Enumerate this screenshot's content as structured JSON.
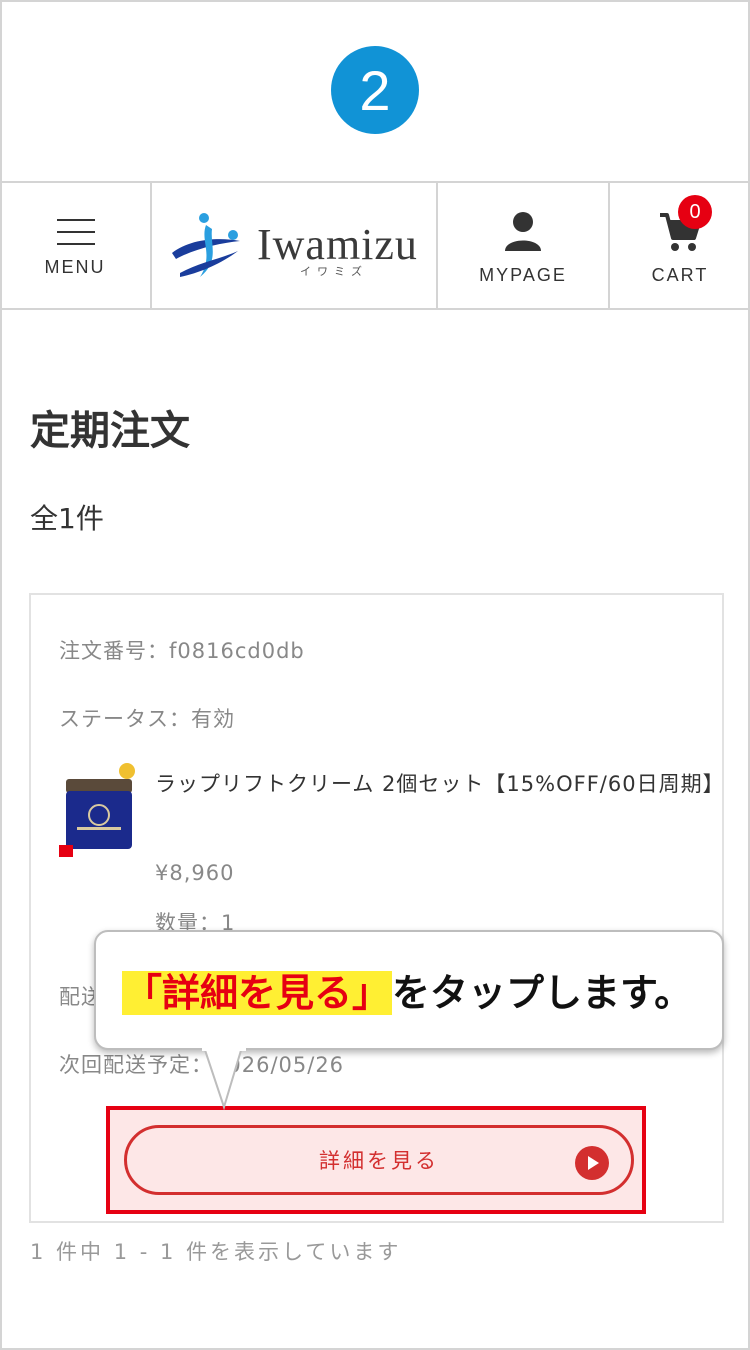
{
  "step": {
    "number": "2"
  },
  "header": {
    "menu_label": "MENU",
    "logo": {
      "text": "Iwamizu",
      "kana": "イワミズ"
    },
    "mypage_label": "MYPAGE",
    "cart_label": "CART",
    "cart_count": "0"
  },
  "page": {
    "title": "定期注文",
    "count_text": "全1件"
  },
  "order": {
    "number_text": "注文番号：f0816cd0db",
    "status_text": "ステータス：有効",
    "product_name": "ラップリフトクリーム 2個セット【15%OFF/60日周期】",
    "price": "¥8,960",
    "quantity_text": "数量：1",
    "delivery_text": "配送",
    "next_delivery_prefix": "次回配送予定",
    "next_delivery_suffix": "：2026/05/26",
    "detail_button_label": "詳細を見る"
  },
  "pager_text": "1 件中 1 - 1 件を表示しています",
  "callout": {
    "highlight": "「詳細を見る」",
    "rest": "をタップします。"
  },
  "colors": {
    "step_badge": "#1193d6",
    "accent_red": "#e60012",
    "button_red": "#d32f2f",
    "highlight_yellow": "#ffef33"
  }
}
